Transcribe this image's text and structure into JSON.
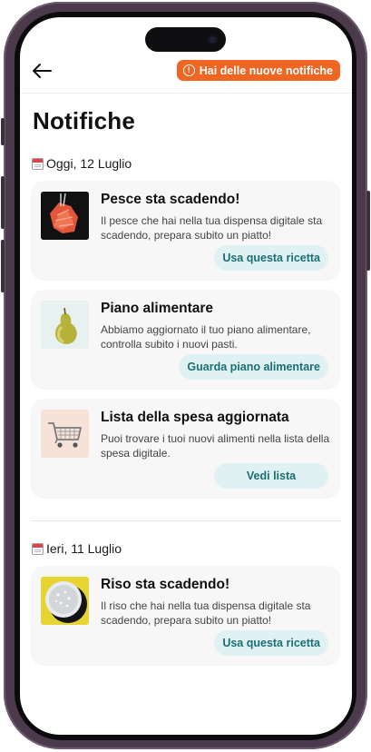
{
  "header": {
    "back_icon": "arrow-left-icon",
    "notification_pill": "Hai delle nuove notifiche",
    "pill_icon": "alert-circle-icon",
    "pill_color": "#ef6522"
  },
  "page_title": "Notifiche",
  "sections": [
    {
      "date_label": "Oggi, 12 Luglio",
      "cards": [
        {
          "title": "Pesce sta scadendo!",
          "body": "Il pesce che hai nella tua dispensa digitale sta scadendo, prepara subito un piatto!",
          "button": "Usa questa ricetta",
          "thumb_icon": "salmon-icon"
        },
        {
          "title": "Piano alimentare",
          "body": "Abbiamo aggiornato il tuo piano alimentare, controlla subito i nuovi pasti.",
          "button": "Guarda piano alimentare",
          "thumb_icon": "pear-icon"
        },
        {
          "title": "Lista della spesa aggiornata",
          "body": "Puoi trovare i tuoi nuovi alimenti nella lista della spesa digitale.",
          "button": "Vedi lista",
          "thumb_icon": "shopping-cart-icon"
        }
      ]
    },
    {
      "date_label": "Ieri, 11 Luglio",
      "cards": [
        {
          "title": "Riso sta scadendo!",
          "body": "Il riso che hai nella tua dispensa digitale sta scadendo, prepara subito un piatto!",
          "button": "Usa questa ricetta",
          "thumb_icon": "rice-bowl-icon"
        }
      ]
    }
  ],
  "colors": {
    "accent": "#ef6522",
    "button_bg": "#dff1f3",
    "button_text": "#1b6e73",
    "card_bg": "#f7f7f8"
  }
}
